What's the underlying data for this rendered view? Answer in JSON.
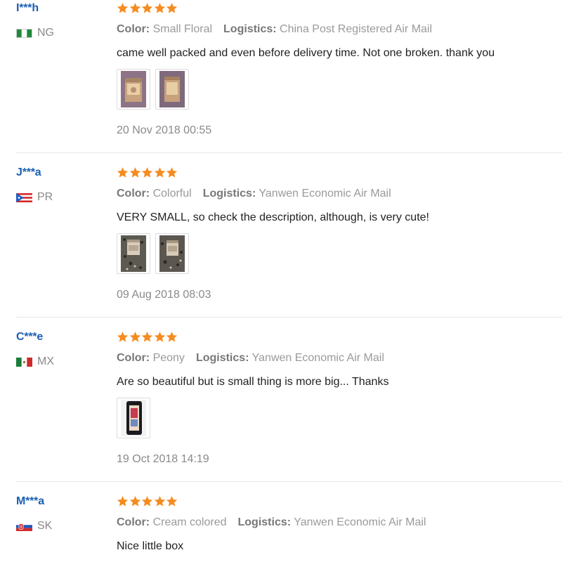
{
  "colors": {
    "username": "#1a5fb4",
    "star": "#f68b1e",
    "label": "#777777",
    "value": "#9a9a9a",
    "text": "#222222",
    "divider": "#e6e6e6"
  },
  "labels": {
    "color": "Color:",
    "logistics": "Logistics:"
  },
  "reviews": [
    {
      "user": "I***h",
      "country": "NG",
      "flag_icon": "nigeria-flag-icon",
      "rating": 5,
      "color": "Small Floral",
      "logistics": "China Post Registered Air Mail",
      "text": "came well packed and even before delivery time. Not one broken. thank you",
      "photos": 2,
      "date": "20 Nov 2018 00:55"
    },
    {
      "user": "J***a",
      "country": "PR",
      "flag_icon": "puerto-rico-flag-icon",
      "rating": 5,
      "color": "Colorful",
      "logistics": "Yanwen Economic Air Mail",
      "text": "VERY SMALL, so check the description, although, is very cute!",
      "photos": 2,
      "date": "09 Aug 2018 08:03"
    },
    {
      "user": "C***e",
      "country": "MX",
      "flag_icon": "mexico-flag-icon",
      "rating": 5,
      "color": "Peony",
      "logistics": "Yanwen Economic Air Mail",
      "text": "Are so beautiful but is small thing is more big... Thanks",
      "photos": 1,
      "date": "19 Oct 2018 14:19"
    },
    {
      "user": "M***a",
      "country": "SK",
      "flag_icon": "slovakia-flag-icon",
      "rating": 5,
      "color": "Cream colored",
      "logistics": "Yanwen Economic Air Mail",
      "text": "Nice little box",
      "photos": 0,
      "date": ""
    }
  ]
}
